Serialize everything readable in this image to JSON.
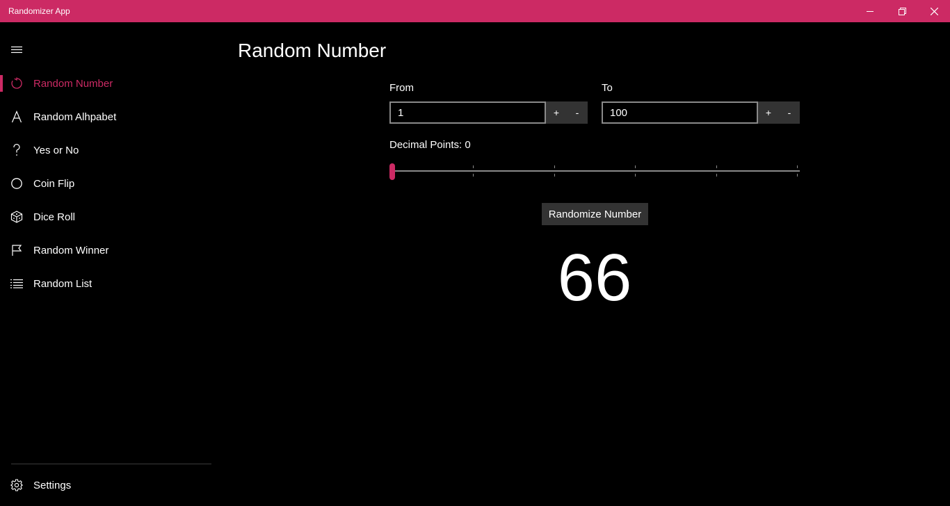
{
  "window": {
    "title": "Randomizer App",
    "accent_color": "#cc2a64"
  },
  "sidebar": {
    "menu_icon": "hamburger-icon",
    "items": [
      {
        "label": "Random Number",
        "icon": "refresh-icon",
        "selected": true
      },
      {
        "label": "Random Alhpabet",
        "icon": "letter-a-icon",
        "selected": false
      },
      {
        "label": "Yes or No",
        "icon": "question-icon",
        "selected": false
      },
      {
        "label": "Coin Flip",
        "icon": "circle-icon",
        "selected": false
      },
      {
        "label": "Dice Roll",
        "icon": "dice-icon",
        "selected": false
      },
      {
        "label": "Random Winner",
        "icon": "flag-icon",
        "selected": false
      },
      {
        "label": "Random List",
        "icon": "list-icon",
        "selected": false
      }
    ],
    "settings": {
      "label": "Settings",
      "icon": "gear-icon"
    }
  },
  "main": {
    "title": "Random Number",
    "from": {
      "label": "From",
      "value": "1",
      "plus": "+",
      "minus": "-"
    },
    "to": {
      "label": "To",
      "value": "100",
      "plus": "+",
      "minus": "-"
    },
    "decimal": {
      "label": "Decimal Points: 0",
      "value": 0,
      "min": 0,
      "max": 5
    },
    "randomize_button": "Randomize Number",
    "result": "66"
  }
}
